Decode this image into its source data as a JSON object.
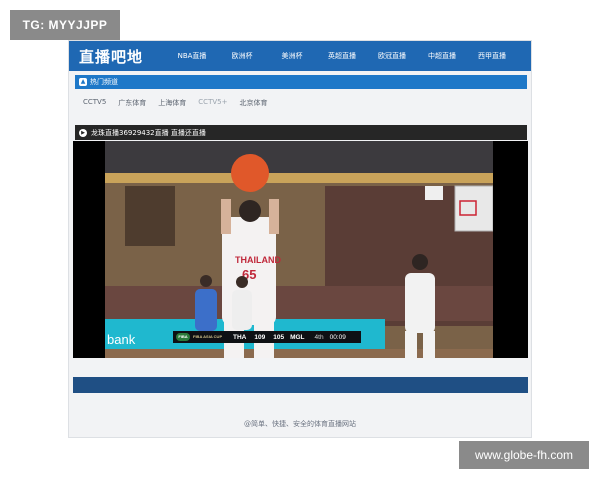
{
  "watermark_top": "TG: MYYJJPP",
  "watermark_bottom": "www.globe-fh.com",
  "site": {
    "logo": "直播吧地",
    "nav": [
      "NBA直播",
      "欧洲杯",
      "美洲杯",
      "英超直播",
      "欧冠直播",
      "中超直播",
      "西甲直播"
    ]
  },
  "hot_section": {
    "title": "热门频道"
  },
  "channels": [
    "CCTV5",
    "广东体育",
    "上海体育",
    "CCTV5+",
    "北京体育"
  ],
  "stream_title": "龙珠直播36929432直播 直播还直播",
  "scoreboard": {
    "event": "FIBA ASIA CUP",
    "home": "THA",
    "home_score": "109",
    "away_score": "105",
    "away": "MGL",
    "quarter": "4th",
    "clock": "00:09"
  },
  "player_jersey": {
    "team": "THAILAND",
    "number": "65"
  },
  "ad_text": "bank",
  "footer": "@简单、快捷、安全的体育直播网站",
  "colors": {
    "nav": "#1f68b3",
    "footer_stripe": "#1f4f84",
    "title_bar": "#262626"
  }
}
